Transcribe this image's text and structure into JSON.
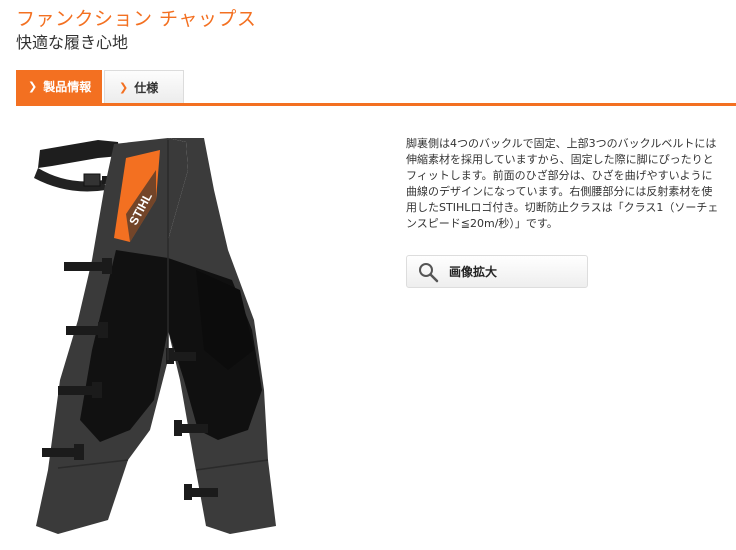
{
  "header": {
    "title": "ファンクション チャップス",
    "subtitle": "快適な履き心地"
  },
  "tabs": [
    {
      "label": "製品情報",
      "active": true
    },
    {
      "label": "仕様",
      "active": false
    }
  ],
  "product": {
    "logo_text": "STIHL",
    "description": "脚裏側は4つのバックルで固定、上部3つのバックルベルトには伸縮素材を採用していますから、固定した際に脚にぴったりとフィットします。前面のひざ部分は、ひざを曲げやすいように曲線のデザインになっています。右側腰部分には反射素材を使用したSTIHLロゴ付き。切断防止クラスは「クラス1（ソーチェンスピード≦20m/秒）」です。"
  },
  "zoom_button": {
    "label": "画像拡大",
    "icon": "magnifier-icon"
  },
  "colors": {
    "accent": "#f37021",
    "text": "#333333"
  }
}
